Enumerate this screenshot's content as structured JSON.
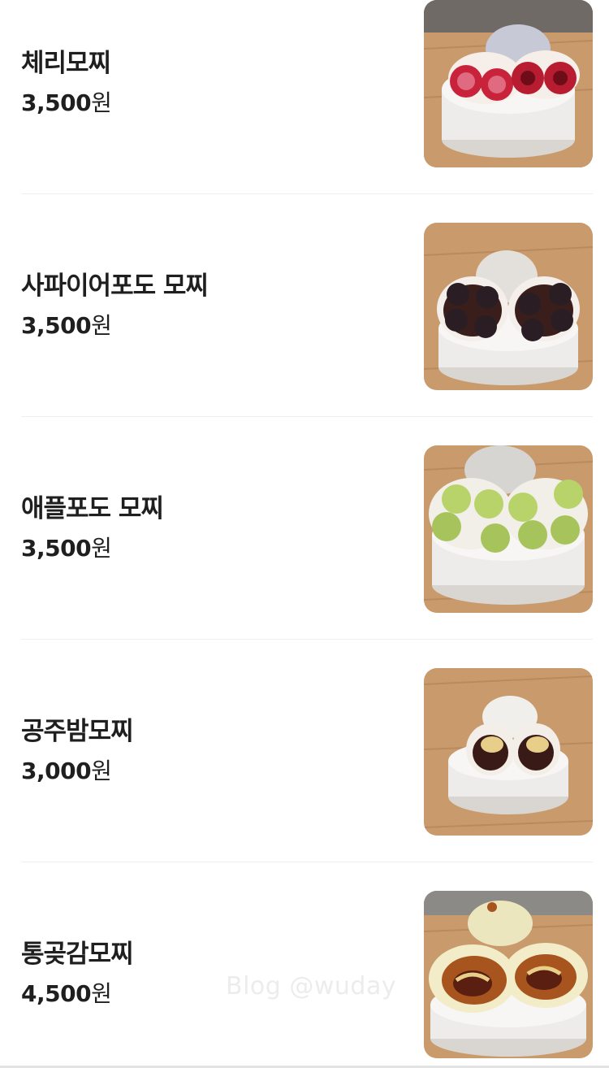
{
  "menu": {
    "items": [
      {
        "name": "체리모찌",
        "price_amount": "3,500",
        "price_unit": "원",
        "image_icon": "cherry-mochi-photo"
      },
      {
        "name": "사파이어포도 모찌",
        "price_amount": "3,500",
        "price_unit": "원",
        "image_icon": "sapphire-grape-mochi-photo"
      },
      {
        "name": "애플포도 모찌",
        "price_amount": "3,500",
        "price_unit": "원",
        "image_icon": "apple-grape-mochi-photo"
      },
      {
        "name": "공주밤모찌",
        "price_amount": "3,000",
        "price_unit": "원",
        "image_icon": "chestnut-mochi-photo"
      },
      {
        "name": "통곶감모찌",
        "price_amount": "4,500",
        "price_unit": "원",
        "image_icon": "dried-persimmon-mochi-photo"
      }
    ]
  },
  "watermark": "Blog @wuday",
  "colors": {
    "text": "#1f1f1f",
    "divider": "#efefef",
    "table_wood": "#c99a6c",
    "plate": "#f4f2ef",
    "cherry": "#c8233a",
    "grape_dark": "#2a1e24",
    "grape_green": "#b7d36a",
    "red_bean": "#3a1a16",
    "chestnut": "#e7cf8a",
    "persimmon": "#a8541e"
  }
}
